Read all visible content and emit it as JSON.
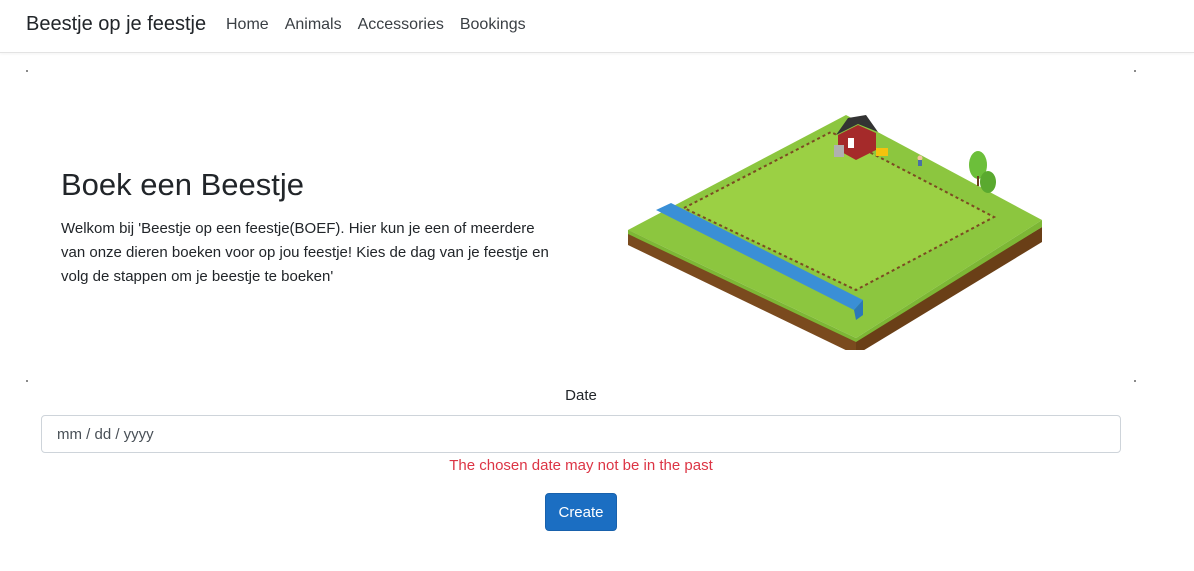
{
  "navbar": {
    "brand": "Beestje op je feestje",
    "links": [
      "Home",
      "Animals",
      "Accessories",
      "Bookings"
    ]
  },
  "hero": {
    "title": "Boek een Beestje",
    "text": "Welkom bij 'Beestje op een feestje(BOEF). Hier kun je een of meerdere van onze dieren boeken voor op jou feestje! Kies de dag van je feestje en volg de stappen om je beestje te boeken'",
    "image": "isometric-farm-illustration"
  },
  "form": {
    "date_label": "Date",
    "date_placeholder": "mm / dd / yyyy",
    "error": "The chosen date may not be in the past",
    "submit_label": "Create"
  },
  "colors": {
    "primary": "#1b6ec2",
    "danger": "#dc3545",
    "grass": "#8cc63f",
    "soil": "#7a4a1e",
    "water": "#3a8fd6"
  }
}
